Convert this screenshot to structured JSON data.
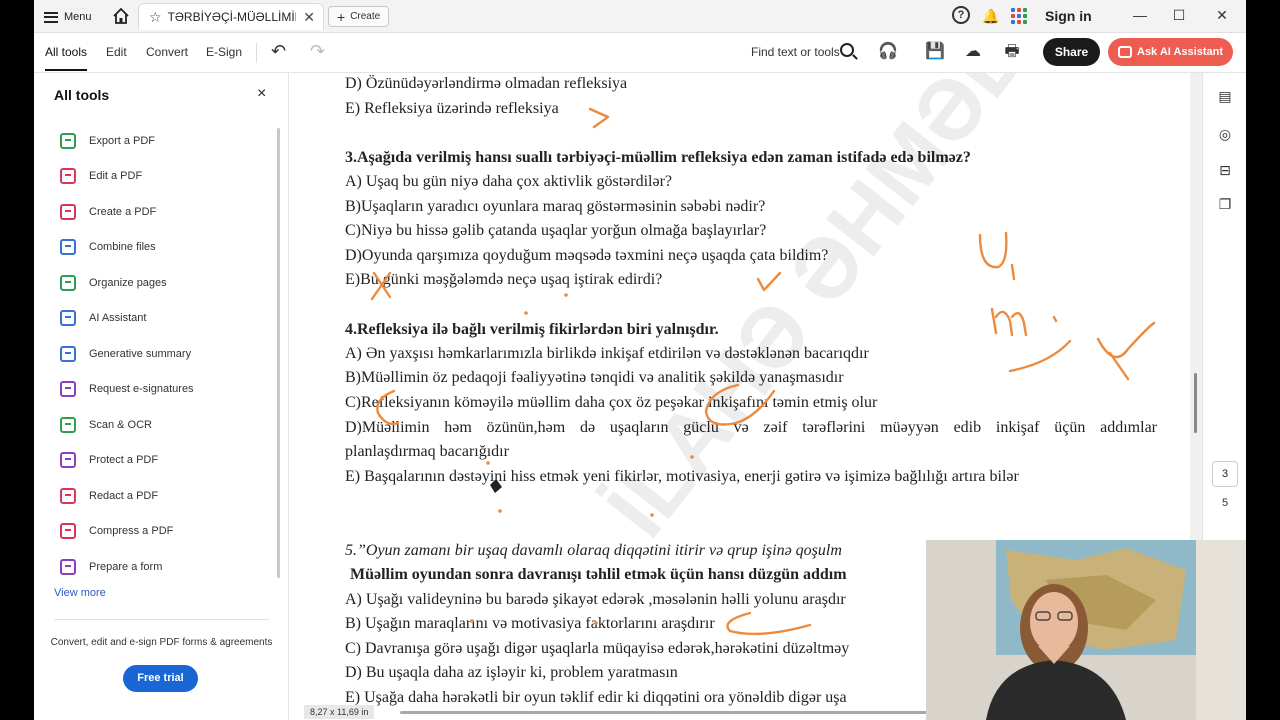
{
  "titlebar": {
    "menu_label": "Menu",
    "tab_title": "TƏRBİYƏÇİ-MÜƏLLİMİN...",
    "create_label": "Create",
    "signin_label": "Sign in",
    "help_glyph": "?",
    "minimize": "—",
    "maximize": "☐",
    "close": "✕"
  },
  "toolbar": {
    "tabs": [
      {
        "label": "All tools"
      },
      {
        "label": "Edit"
      },
      {
        "label": "Convert"
      },
      {
        "label": "E-Sign"
      }
    ],
    "find_label": "Find text or tools",
    "share_label": "Share",
    "ai_label": "Ask AI Assistant"
  },
  "sidebar": {
    "title": "All tools",
    "close": "×",
    "items": [
      {
        "label": "Export a PDF",
        "color": "#2e9e4f"
      },
      {
        "label": "Edit a PDF",
        "color": "#d9345a"
      },
      {
        "label": "Create a PDF",
        "color": "#d9345a"
      },
      {
        "label": "Combine files",
        "color": "#3a6fd8"
      },
      {
        "label": "Organize pages",
        "color": "#2e9e4f"
      },
      {
        "label": "AI Assistant",
        "color": "#3a6fd8"
      },
      {
        "label": "Generative summary",
        "color": "#3a6fd8"
      },
      {
        "label": "Request e-signatures",
        "color": "#8a3fbf"
      },
      {
        "label": "Scan & OCR",
        "color": "#2e9e4f"
      },
      {
        "label": "Protect a PDF",
        "color": "#8a3fbf"
      },
      {
        "label": "Redact a PDF",
        "color": "#d9345a"
      },
      {
        "label": "Compress a PDF",
        "color": "#d9345a"
      },
      {
        "label": "Prepare a form",
        "color": "#8a3fbf"
      }
    ],
    "view_more": "View more",
    "promo": "Convert, edit and e-sign PDF forms & agreements",
    "trial_label": "Free trial"
  },
  "document": {
    "lines": [
      {
        "text": "D) Özünüdəyərləndirmə olmadan refleksiya",
        "style": "normal"
      },
      {
        "text": "E) Refleksiya üzərində refleksiya",
        "style": "normal"
      },
      {
        "text": "3.Aşağıda verilmiş hansı suallı tərbiyəçi-müəllim refleksiya edən zaman istifadə edə bilməz?",
        "style": "bold"
      },
      {
        "text": "A) Uşaq bu gün niyə daha çox aktivlik göstərdilər?",
        "style": "normal"
      },
      {
        "text": "B)Uşaqların yaradıcı oyunlara maraq göstərməsinin səbəbi nədir?",
        "style": "normal"
      },
      {
        "text": "C)Niyə bu hissə gəlib çatanda uşaqlar yorğun olmağa başlayırlar?",
        "style": "normal"
      },
      {
        "text": "D)Oyunda qarşımıza qoyduğum məqsədə təxmini neçə uşaqda çata bildim?",
        "style": "normal"
      },
      {
        "text": "E)Bu günki məşğələmdə neçə uşaq iştirak edirdi?",
        "style": "normal"
      },
      {
        "text": "4.Refleksiya ilə bağlı verilmiş fikirlərdən biri yalnışdır.",
        "style": "bold"
      },
      {
        "text": "A) Ən yaxşısı həmkarlarımızla birlikdə inkişaf etdirilən və dəstəklənən bacarıqdır",
        "style": "normal"
      },
      {
        "text": "B)Müəllimin öz pedaqoji fəaliyyətinə tənqidi və analitik şəkildə yanaşmasıdır",
        "style": "normal"
      },
      {
        "text": "C)Refleksiyanın köməyilə müəllim daha çox öz peşəkar inkişafını təmin etmiş olur",
        "style": "normal"
      },
      {
        "text": "D)Müəllimin həm özünün,həm də uşaqların güclü və zəif tərəflərini müəyyən edib inkişaf üçün addımlar",
        "style": "justify"
      },
      {
        "text": "planlaşdırmaq bacarığıdır",
        "style": "normal"
      },
      {
        "text": "E) Başqalarının dəstəyini hiss etmək yeni fikirlər, motivasiya, enerji gətirə və işimizə bağlılığı artıra bilər",
        "style": "normal"
      },
      {
        "text": "5.”Oyun zamanı bir uşaq davamlı olaraq diqqətini itirir və qrup işinə qoşulm",
        "style": "italic"
      },
      {
        "text": "Müəllim oyundan sonra davranışı təhlil etmək üçün hansı düzgün addım",
        "style": "bold"
      },
      {
        "text": "A) Uşağı valideyninə bu barədə şikayət edərək ,məsələnin həlli yolunu araşdır",
        "style": "normal"
      },
      {
        "text": "B) Uşağın maraqlarını və motivasiya faktorlarını araşdırır",
        "style": "normal"
      },
      {
        "text": "C) Davranışa görə uşağı digər uşaqlarla müqayisə edərək,hərəkətini düzəltməy",
        "style": "normal"
      },
      {
        "text": "D) Bu uşaqla daha az işləyir ki, problem yaratmasın",
        "style": "normal"
      },
      {
        "text": "E) Uşağa daha hərəkətli bir oyun təklif edir ki diqqətini ora yönəldib digər uşa",
        "style": "normal"
      }
    ],
    "dimension": "8,27 x 11,69 in"
  },
  "rail": {
    "current_page": "3",
    "total_pages": "5"
  },
  "colors": {
    "annotation": "#ee8a3c",
    "share_bg": "#1b1b1b",
    "ai_bg": "#ef5c50",
    "trial_bg": "#1a66d4"
  }
}
